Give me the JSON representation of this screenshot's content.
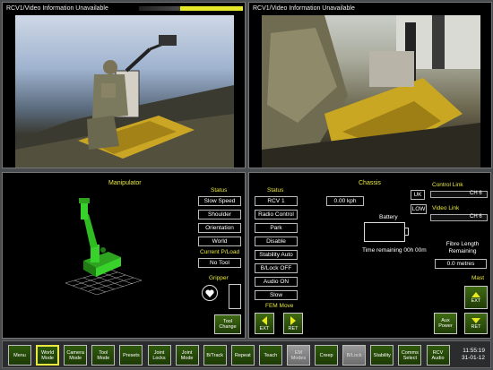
{
  "video": {
    "left_title": "RCV1/Video Information Unavailable",
    "right_title": "RCV1/Video Information Unavailable",
    "left_signal_level": 0.6
  },
  "manipulator": {
    "title": "Manipulator",
    "status_label": "Status",
    "status_items": [
      "Slow Speed",
      "Shoulder",
      "Orientation",
      "World"
    ],
    "payload_label": "Current P/Load",
    "payload_value": "No Tool",
    "gripper_label": "Gripper",
    "gripper_icon": "heart-icon",
    "tool_change_label": "Tool Change"
  },
  "chassis": {
    "title": "Chassis",
    "status_label": "Status",
    "status_items": [
      "RCV 1",
      "Radio Control",
      "Park",
      "Disable",
      "Stability Auto",
      "B/Lock OFF",
      "Audio ON",
      "Slow"
    ],
    "fem_move_label": "FEM Move",
    "ext_label": "EXT",
    "ret_label": "RET",
    "speed": "0.00 kph",
    "uk_label": "UK",
    "low_label": "LOW",
    "battery_label": "Battery",
    "time_remaining": "Time remaining 00h 00m",
    "control_link_label": "Control Link",
    "control_link_channel": "CH 6",
    "video_link_label": "Video Link",
    "video_link_channel": "CH 6",
    "fibre_label": "Fibre Length Remaining",
    "fibre_value": "0.0 metres",
    "mast_label": "Mast",
    "mast_ext_label": "EXT",
    "mast_ret_label": "RET",
    "aux_power_label": "Aux Power"
  },
  "toolbar": {
    "buttons": [
      {
        "label": "Menu",
        "state": "normal"
      },
      {
        "label": "World Mode",
        "state": "active"
      },
      {
        "label": "Camera Mode",
        "state": "normal"
      },
      {
        "label": "Tool Mode",
        "state": "normal"
      },
      {
        "label": "Presets",
        "state": "normal"
      },
      {
        "label": "Joint Locks",
        "state": "normal"
      },
      {
        "label": "Joint Mode",
        "state": "normal"
      },
      {
        "label": "B/Track",
        "state": "normal"
      },
      {
        "label": "Repeat",
        "state": "normal"
      },
      {
        "label": "Teach",
        "state": "normal"
      },
      {
        "label": "EM Modes",
        "state": "disabled"
      },
      {
        "label": "Creep",
        "state": "normal"
      },
      {
        "label": "B/Lock",
        "state": "disabled"
      },
      {
        "label": "Stability",
        "state": "normal"
      },
      {
        "label": "Comms Select",
        "state": "normal"
      },
      {
        "label": "RCV Audio",
        "state": "normal"
      }
    ],
    "time": "11:55:19",
    "date": "31-01-12"
  },
  "colors": {
    "accent_yellow": "#e8e840",
    "button_green": "#2f5a0c",
    "arm_green": "#39d12b"
  }
}
